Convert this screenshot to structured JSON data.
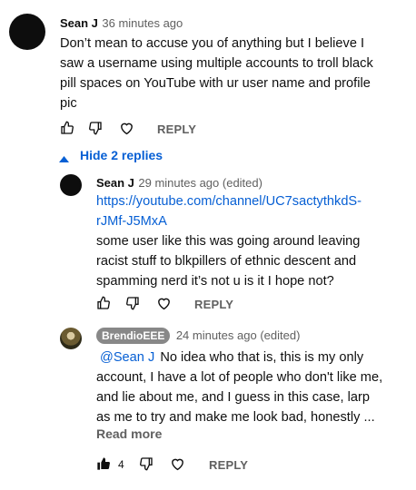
{
  "comment": {
    "author": "Sean J",
    "time": "36 minutes ago",
    "lines": [
      "Don’t mean to accuse you of anything but I believe I",
      "saw a username using multiple accounts to troll black",
      "pill spaces on YouTube with ur user name and profile",
      "pic"
    ],
    "reply_label": "REPLY",
    "toggle_label": "Hide 2 replies"
  },
  "replies": [
    {
      "author": "Sean J",
      "time": "29 minutes ago (edited)",
      "link_lines": [
        "https://youtube.com/channel/UC7sactythkdS-",
        "rJMf-J5MxA"
      ],
      "lines": [
        "some user like this was going around leaving",
        "racist stuff to blkpillers of ethnic descent and",
        "spamming nerd it’s not u is it I hope not?"
      ],
      "reply_label": "REPLY"
    },
    {
      "author": "BrendioEEE",
      "time": "24 minutes ago (edited)",
      "mention": "@Sean J",
      "first_line_rest": "No idea who that is, this is my only",
      "lines": [
        "account, I have a lot of people who don't like me,",
        "and lie about me, and I guess in this case, larp",
        "as me to try and make me look bad, honestly ..."
      ],
      "read_more": "Read more",
      "like_count": "4",
      "reply_label": "REPLY"
    }
  ],
  "icons": {
    "like": "thumb-up-outline",
    "dislike": "thumb-down-outline",
    "heart": "heart-outline",
    "like_filled": "thumb-up-filled",
    "caret": "caret-up"
  },
  "colors": {
    "link": "#065fd4",
    "meta": "#606060",
    "badge": "#888888"
  }
}
